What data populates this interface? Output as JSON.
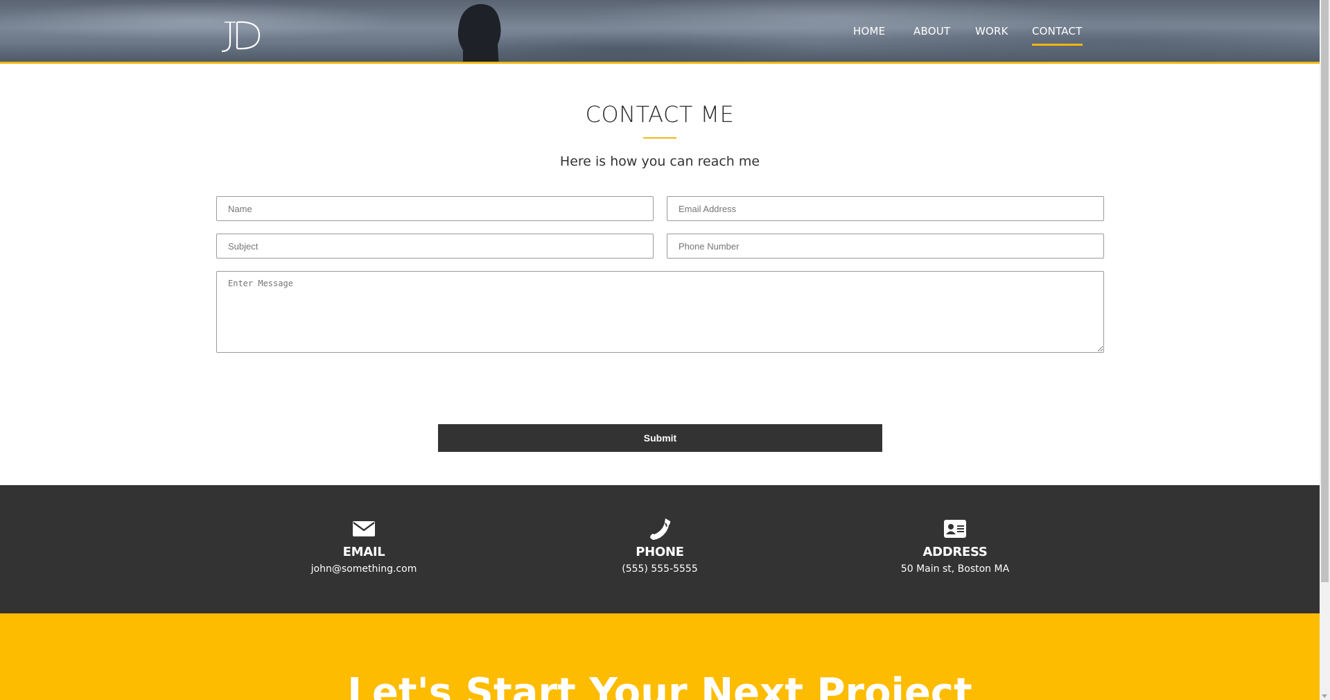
{
  "header": {
    "logo_text": "JD",
    "nav": [
      {
        "label": "HOME",
        "active": false
      },
      {
        "label": "ABOUT",
        "active": false
      },
      {
        "label": "WORK",
        "active": false
      },
      {
        "label": "CONTACT",
        "active": true
      }
    ]
  },
  "contact": {
    "title": "CONTACT ME",
    "subtitle": "Here is how you can reach me",
    "form": {
      "name_placeholder": "Name",
      "email_placeholder": "Email Address",
      "subject_placeholder": "Subject",
      "phone_placeholder": "Phone Number",
      "message_placeholder": "Enter Message",
      "submit_label": "Submit"
    }
  },
  "info": {
    "email": {
      "icon": "envelope-icon",
      "label": "EMAIL",
      "value": "john@something.com"
    },
    "phone": {
      "icon": "phone-icon",
      "label": "PHONE",
      "value": "(555) 555-5555"
    },
    "address": {
      "icon": "address-card-icon",
      "label": "ADDRESS",
      "value": "50 Main st, Boston MA"
    }
  },
  "cta": {
    "title": "Let's Start Your Next Project"
  },
  "colors": {
    "accent": "#f0b712",
    "dark": "#333333",
    "cta_background": "#fdbc00"
  }
}
